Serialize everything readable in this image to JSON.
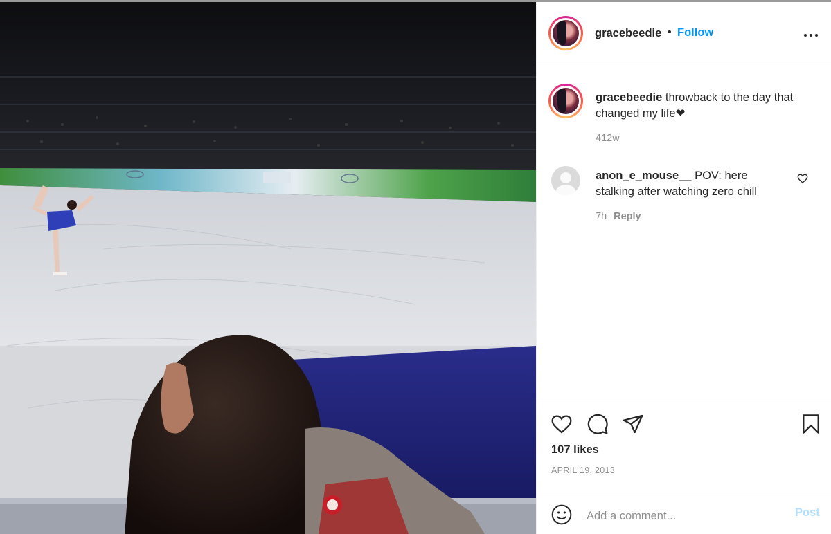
{
  "post": {
    "image_alt": "Figure skater performing at Olympic rink, spectator in foreground",
    "author": {
      "username": "gracebeedie",
      "separator": "•",
      "follow_label": "Follow",
      "more_label": "More options"
    },
    "caption": {
      "username": "gracebeedie",
      "text": " throwback to the day that changed my life❤",
      "age": "412w"
    },
    "comments": [
      {
        "username": "anon_e_mouse__",
        "text": " POV: here stalking after watching zero chill",
        "age": "7h",
        "reply_label": "Reply"
      }
    ],
    "likes": "107 likes",
    "date": "APRIL 19, 2013",
    "add_comment": {
      "placeholder": "Add a comment...",
      "post_label": "Post"
    }
  },
  "icons": {
    "like": "heart-icon",
    "comment": "comment-icon",
    "share": "share-icon",
    "save": "bookmark-icon",
    "emoji": "emoji-icon",
    "comment_like": "small-heart-icon",
    "more": "more-icon"
  },
  "colors": {
    "follow": "#0095f6",
    "post_disabled": "#b2dffc",
    "text": "#262626",
    "secondary": "#8e8e8e"
  }
}
